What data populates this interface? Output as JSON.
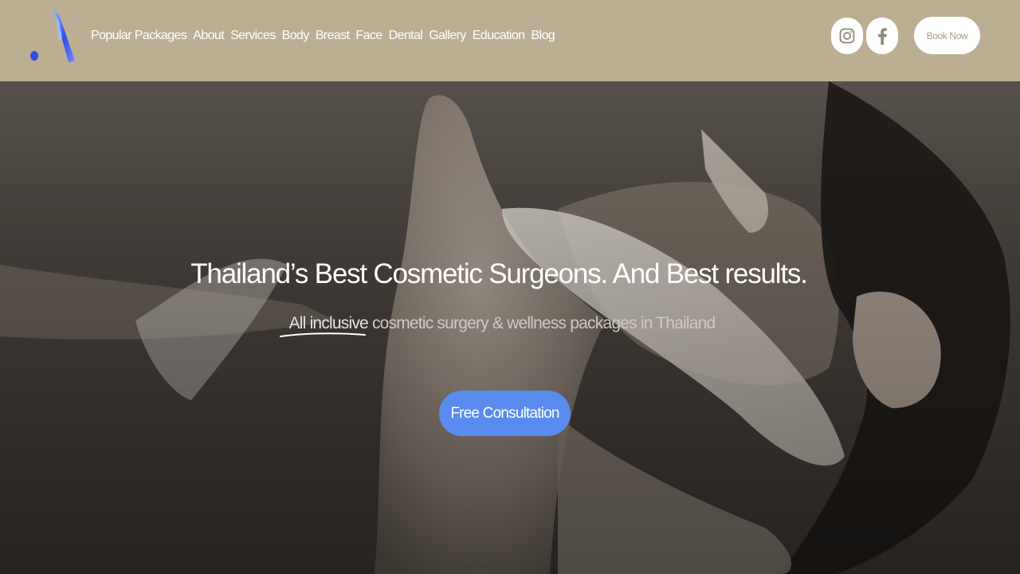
{
  "header": {
    "logo_icon": "brand-a-logo",
    "nav_items": [
      "Popular Packages",
      "About",
      "Services",
      "Body",
      "Breast",
      "Face",
      "Dental",
      "Gallery",
      "Education",
      "Blog"
    ],
    "social": [
      {
        "icon": "instagram-icon"
      },
      {
        "icon": "facebook-icon"
      }
    ],
    "book_label": "Book Now"
  },
  "hero": {
    "title": "Thailand’s Best Cosmetic Surgeons. And Best results.",
    "subtitle_highlight": "All inclusive",
    "subtitle_rest": " cosmetic surgery & wellness packages in Thailand",
    "cta_label": "Free Consultation"
  },
  "colors": {
    "header_bg": "#bcae92",
    "cta_bg": "#5a8cf0",
    "button_text": "#a99b82",
    "logo_blue": "#3b5cf0"
  }
}
